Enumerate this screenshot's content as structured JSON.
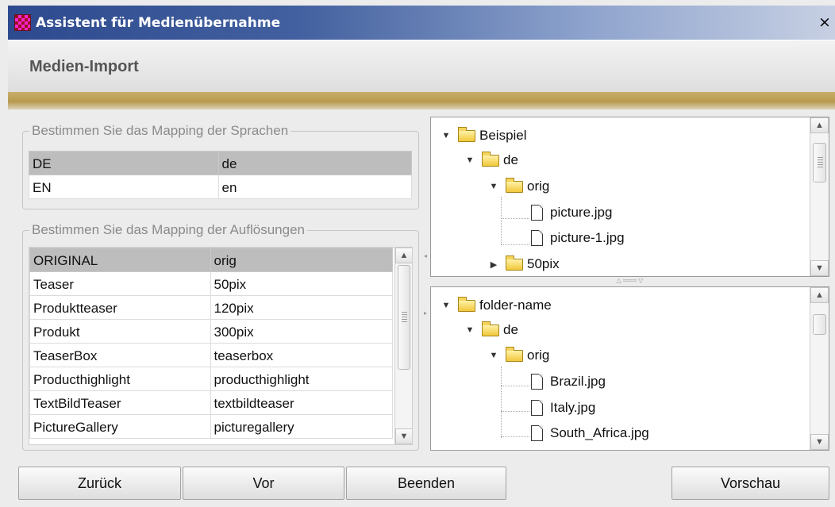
{
  "window": {
    "title": "Assistent für Medienübernahme",
    "close_label": "×"
  },
  "header": {
    "title": "Medien-Import"
  },
  "languages": {
    "legend": "Bestimmen Sie das Mapping der Sprachen",
    "rows": [
      {
        "key": "DE",
        "value": "de",
        "selected": true
      },
      {
        "key": "EN",
        "value": "en",
        "selected": false
      }
    ]
  },
  "resolutions": {
    "legend": "Bestimmen Sie das Mapping der Auflösungen",
    "rows": [
      {
        "key": "ORIGINAL",
        "value": "orig",
        "selected": true
      },
      {
        "key": "Teaser",
        "value": "50pix",
        "selected": false
      },
      {
        "key": "Produktteaser",
        "value": "120pix",
        "selected": false
      },
      {
        "key": "Produkt",
        "value": "300pix",
        "selected": false
      },
      {
        "key": "TeaserBox",
        "value": "teaserbox",
        "selected": false
      },
      {
        "key": "Producthighlight",
        "value": "producthighlight",
        "selected": false
      },
      {
        "key": "TextBildTeaser",
        "value": "textbildteaser",
        "selected": false
      },
      {
        "key": "PictureGallery",
        "value": "picturegallery",
        "selected": false
      }
    ]
  },
  "tree_top": {
    "nodes": [
      {
        "label": "Beispiel",
        "type": "folder",
        "expanded": true
      },
      {
        "label": "de",
        "type": "folder",
        "expanded": true
      },
      {
        "label": "orig",
        "type": "folder",
        "expanded": true
      },
      {
        "label": "picture.jpg",
        "type": "file"
      },
      {
        "label": "picture-1.jpg",
        "type": "file"
      },
      {
        "label": "50pix",
        "type": "folder",
        "expanded": false
      }
    ]
  },
  "tree_bottom": {
    "nodes": [
      {
        "label": "folder-name",
        "type": "folder",
        "expanded": true
      },
      {
        "label": "de",
        "type": "folder",
        "expanded": true
      },
      {
        "label": "orig",
        "type": "folder",
        "expanded": true
      },
      {
        "label": "Brazil.jpg",
        "type": "file"
      },
      {
        "label": "Italy.jpg",
        "type": "file"
      },
      {
        "label": "South_Africa.jpg",
        "type": "file"
      }
    ]
  },
  "buttons": {
    "back": "Zurück",
    "next": "Vor",
    "finish": "Beenden",
    "preview": "Vorschau"
  },
  "icons": {
    "app": "media-wizard-icon",
    "folder": "folder-icon",
    "file": "file-icon",
    "expand": "triangle-down-icon",
    "collapse": "triangle-right-icon"
  }
}
